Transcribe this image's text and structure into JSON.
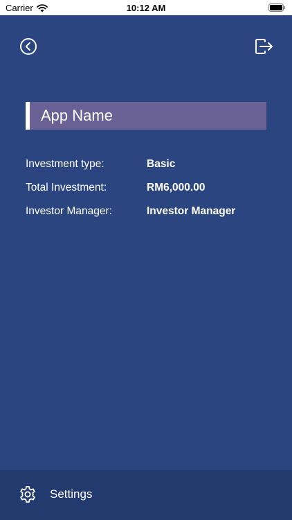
{
  "status_bar": {
    "carrier": "Carrier",
    "time": "10:12 AM"
  },
  "header": {
    "back_icon": "chevron-left-circle-icon",
    "logout_icon": "logout-icon"
  },
  "banner": {
    "title": "App Name"
  },
  "details": [
    {
      "label": "Investment type:",
      "value": "Basic"
    },
    {
      "label": "Total Investment:",
      "value": "RM6,000.00"
    },
    {
      "label": "Investor Manager:",
      "value": "Investor Manager"
    }
  ],
  "bottom_bar": {
    "settings_label": "Settings",
    "settings_icon": "gear-icon"
  },
  "colors": {
    "background": "#2b4580",
    "banner": "#6a6196",
    "bottom_bar": "#233a6e"
  }
}
